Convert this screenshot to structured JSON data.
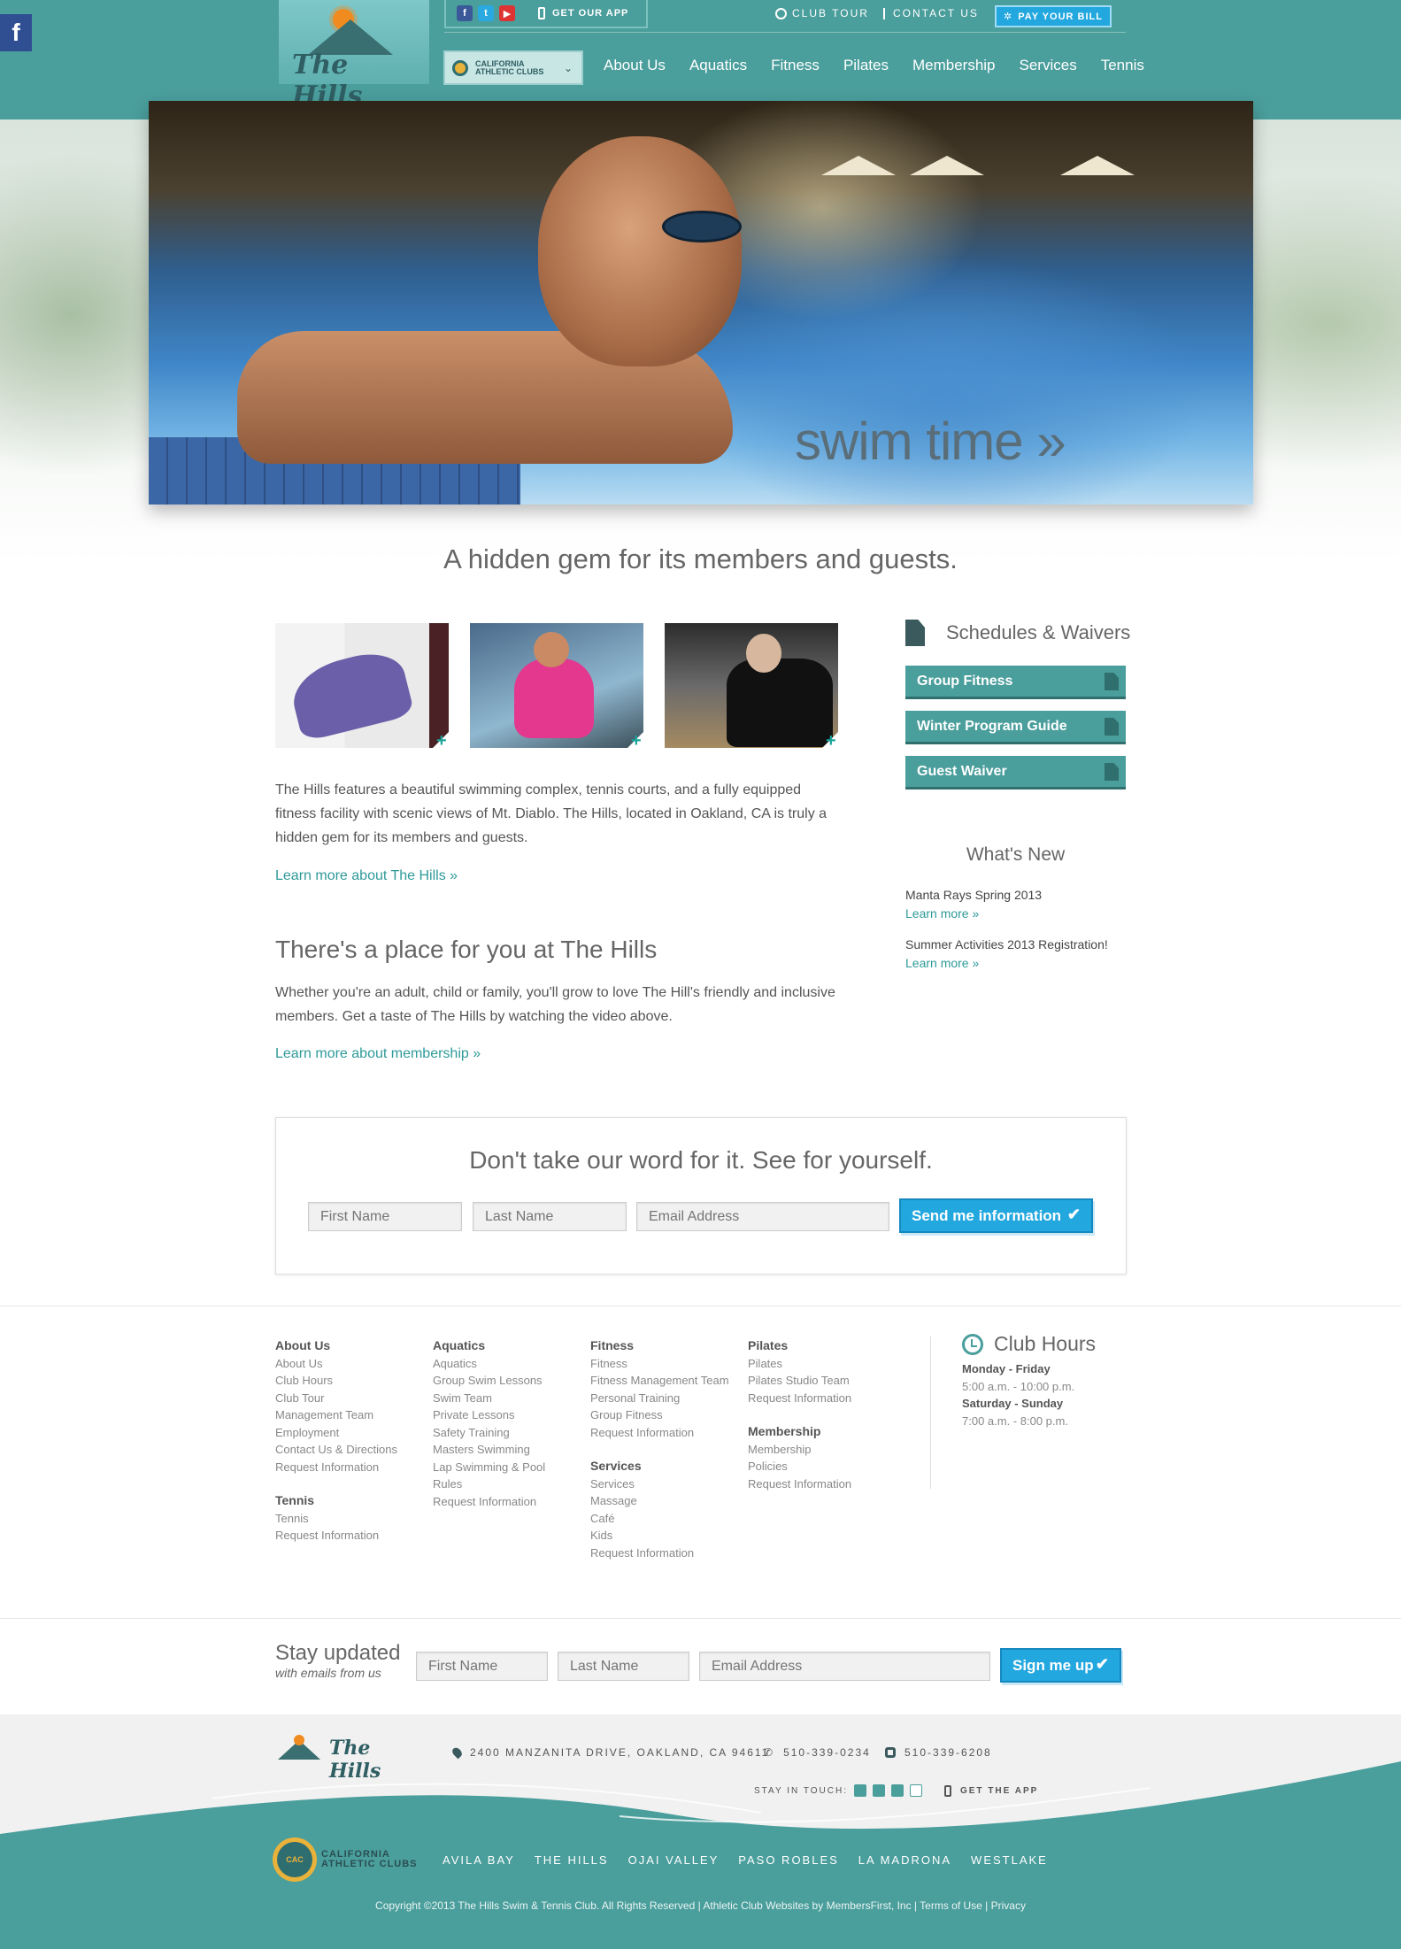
{
  "header": {
    "social": {
      "facebook": "f",
      "twitter": "t",
      "youtube": "▶"
    },
    "get_app": "GET OUR APP",
    "club_tour": "CLUB TOUR",
    "contact_us": "CONTACT US",
    "pay_bill": "PAY YOUR BILL",
    "logo_text": "The Hills",
    "club_select": {
      "line1": "CALIFORNIA",
      "line2": "ATHLETIC CLUBS"
    },
    "nav": [
      "About Us",
      "Aquatics",
      "Fitness",
      "Pilates",
      "Membership",
      "Services",
      "Tennis"
    ],
    "side_tab": "f"
  },
  "hero": {
    "caption": "swim time »"
  },
  "tagline": "A hidden gem for its members and guests.",
  "intro": {
    "paragraph": "The Hills features a beautiful swimming complex, tennis courts, and a fully equipped fitness facility with scenic views of Mt. Diablo. The Hills, located in Oakland, CA is truly a hidden gem for its members and guests.",
    "link": "Learn more about The Hills »"
  },
  "place": {
    "heading": "There's a place for you at The Hills",
    "paragraph": "Whether you're an adult, child or family, you'll grow to love The Hill's friendly and inclusive members. Get a taste of The Hills by watching the video above.",
    "link": "Learn more about membership »"
  },
  "sidebar": {
    "schedules_title": "Schedules & Waivers",
    "buttons": [
      "Group Fitness",
      "Winter Program Guide",
      "Guest Waiver"
    ],
    "whats_new_title": "What's New",
    "news": [
      {
        "title": "Manta Rays Spring 2013",
        "link": "Learn more »"
      },
      {
        "title": "Summer Activities 2013 Registration!",
        "link": "Learn more »"
      }
    ]
  },
  "info_form": {
    "title": "Don't take our word for it. See for yourself.",
    "first_name": "First Name",
    "last_name": "Last Name",
    "email": "Email Address",
    "submit": "Send me information"
  },
  "footer_nav": {
    "about": {
      "heading": "About Us",
      "items": [
        "About Us",
        "Club Hours",
        "Club Tour",
        "Management Team",
        "Employment",
        "Contact Us & Directions",
        "Request Information"
      ]
    },
    "tennis": {
      "heading": "Tennis",
      "items": [
        "Tennis",
        "Request Information"
      ]
    },
    "aquatics": {
      "heading": "Aquatics",
      "items": [
        "Aquatics",
        "Group Swim Lessons",
        "Swim Team",
        "Private Lessons",
        "Safety Training",
        "Masters Swimming",
        "Lap Swimming & Pool",
        "Rules",
        "Request Information"
      ]
    },
    "fitness": {
      "heading": "Fitness",
      "items": [
        "Fitness",
        "Fitness Management Team",
        "Personal Training",
        "Group Fitness",
        "Request Information"
      ]
    },
    "services": {
      "heading": "Services",
      "items": [
        "Services",
        "Massage",
        "Café",
        "Kids",
        "Request Information"
      ]
    },
    "pilates": {
      "heading": "Pilates",
      "items": [
        "Pilates",
        "Pilates Studio Team",
        "Request Information"
      ]
    },
    "membership": {
      "heading": "Membership",
      "items": [
        "Membership",
        "Policies",
        "Request Information"
      ]
    }
  },
  "hours": {
    "title": "Club Hours",
    "weekday_label": "Monday - Friday",
    "weekday_hours": "5:00 a.m. - 10:00 p.m.",
    "weekend_label": "Saturday - Sunday",
    "weekend_hours": "7:00 a.m. - 8:00 p.m."
  },
  "newsletter": {
    "title": "Stay updated",
    "subtitle": "with emails from us",
    "first_name": "First Name",
    "last_name": "Last Name",
    "email": "Email Address",
    "submit": "Sign me up"
  },
  "footer": {
    "logo_text": "The Hills",
    "address": "2400 MANZANITA DRIVE, OAKLAND, CA 94611",
    "phone": "510-339-0234",
    "fax": "510-339-6208",
    "stay_in_touch": "STAY IN TOUCH:",
    "get_app": "GET THE APP",
    "cac_line1": "CALIFORNIA",
    "cac_line2": "ATHLETIC CLUBS",
    "cac_seal": "CAC",
    "clubs": [
      "AVILA BAY",
      "THE HILLS",
      "OJAI VALLEY",
      "PASO ROBLES",
      "LA MADRONA",
      "WESTLAKE"
    ],
    "copyright": "Copyright ©2013 The Hills Swim & Tennis Club. All Rights Reserved | Athletic Club Websites by MembersFirst, Inc | Terms of Use | Privacy"
  },
  "colors": {
    "teal": "#4a9e9c",
    "blue_button": "#22a7df",
    "link": "#2e9a98"
  }
}
